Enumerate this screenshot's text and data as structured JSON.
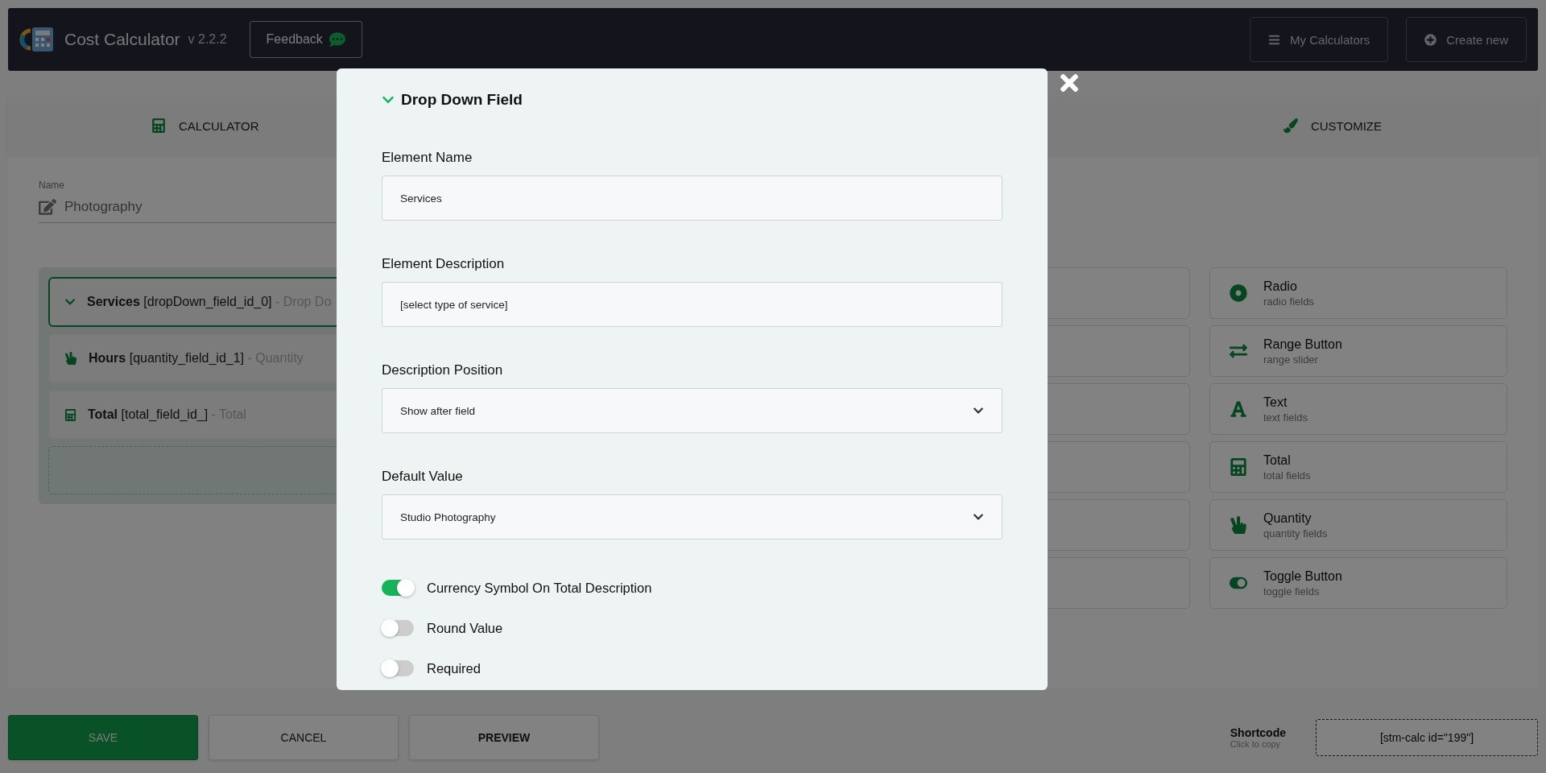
{
  "header": {
    "app_name": "Cost Calculator",
    "version": "v 2.2.2",
    "feedback_button": "Feedback",
    "actions": [
      {
        "label": "My Calculators",
        "kind": "list"
      },
      {
        "label": "Create new",
        "kind": "add"
      }
    ]
  },
  "tabs": [
    {
      "label": "CALCULATOR",
      "kind": "calculator"
    },
    {
      "label": "CUSTOMIZE",
      "kind": "brush"
    }
  ],
  "calculator_name": {
    "label": "Name",
    "value": "Photography"
  },
  "fields": [
    {
      "name": "Services",
      "key": "[dropDown_field_id_0]",
      "type": "- Drop Do",
      "kind": "dropdown",
      "selected": true
    },
    {
      "name": "Hours",
      "key": "[quantity_field_id_1]",
      "type": "- Quantity",
      "kind": "quantity",
      "selected": false
    },
    {
      "name": "Total",
      "key": "[total_field_id_]",
      "type": "- Total",
      "kind": "total",
      "selected": false
    }
  ],
  "widgets": [
    {
      "title": "Radio",
      "subtitle": "radio fields",
      "kind": "radio"
    },
    {
      "title": "Range Button",
      "subtitle": "range slider",
      "kind": "range"
    },
    {
      "title": "Text",
      "subtitle": "text fields",
      "kind": "text"
    },
    {
      "title": "Total",
      "subtitle": "total fields",
      "kind": "total"
    },
    {
      "title": "Quantity",
      "subtitle": "quantity fields",
      "kind": "quantity"
    },
    {
      "title": "Toggle Button",
      "subtitle": "toggle fields",
      "kind": "toggle"
    }
  ],
  "footer": {
    "buttons": [
      {
        "label": "SAVE",
        "kind": "primary"
      },
      {
        "label": "CANCEL",
        "kind": "default"
      },
      {
        "label": "PREVIEW",
        "kind": "strong"
      }
    ],
    "shortcode": {
      "label": "Shortcode",
      "hint": "Click to copy",
      "value": "[stm-calc id=\"199\"]"
    }
  },
  "modal": {
    "title": "Drop Down Field",
    "expanded": true,
    "fields": [
      {
        "label": "Element Name",
        "kind": "input",
        "value": "Services"
      },
      {
        "label": "Element Description",
        "kind": "input",
        "value": "[select type of service]"
      },
      {
        "label": "Description Position",
        "kind": "select",
        "value": "Show after field"
      },
      {
        "label": "Default Value",
        "kind": "select",
        "value": "Studio Photography"
      }
    ],
    "toggles": [
      {
        "label": "Currency Symbol On Total Description",
        "on": true
      },
      {
        "label": "Round Value",
        "on": false
      },
      {
        "label": "Required",
        "on": false
      }
    ]
  }
}
